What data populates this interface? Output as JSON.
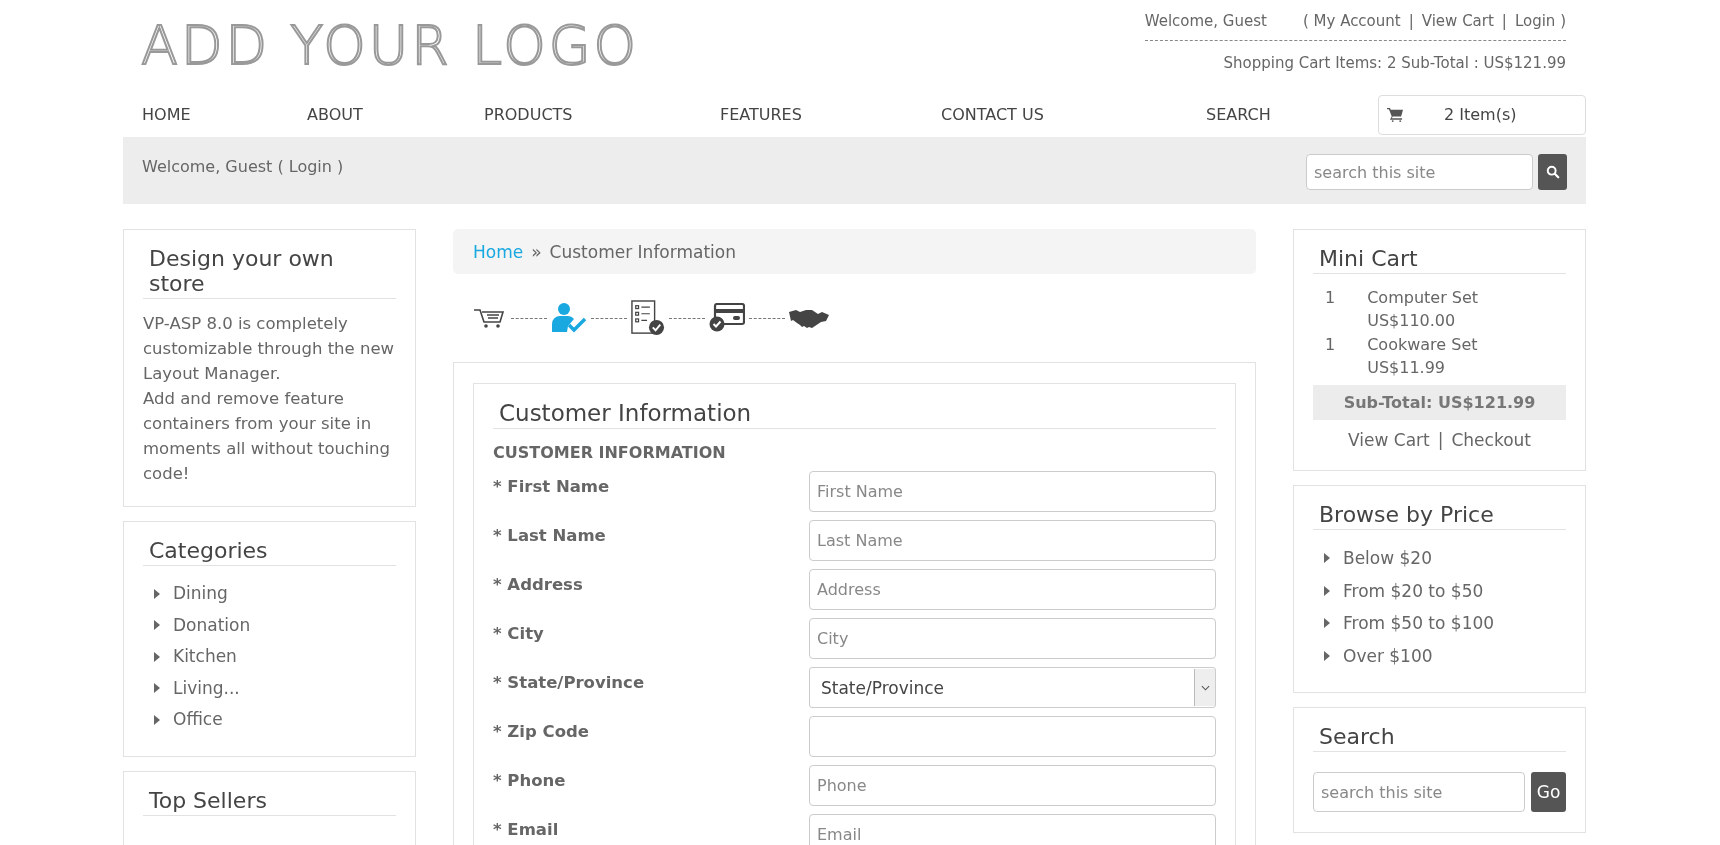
{
  "logo": {
    "text": "ADD YOUR LOGO"
  },
  "account_bar": {
    "welcome": "Welcome, Guest",
    "links": [
      "( My Account",
      "|",
      "View Cart",
      "|",
      "Login )"
    ],
    "cart_summary": "Shopping Cart Items: 2  Sub-Total : US$121.99"
  },
  "nav": {
    "items": [
      "HOME",
      "ABOUT",
      "PRODUCTS",
      "FEATURES",
      "CONTACT US",
      "SEARCH"
    ],
    "cart_button": "2 Item(s)"
  },
  "welcome_bar": {
    "text": "Welcome, Guest ( Login )",
    "search": {
      "placeholder": "search this site"
    }
  },
  "left": {
    "design": {
      "title": "Design your own store",
      "text": "VP-ASP 8.0 is completely customizable through the new Layout Manager.\nAdd and remove feature containers from your site in moments all without touching code!"
    },
    "categories": {
      "title": "Categories",
      "items": [
        "Dining",
        "Donation",
        "Kitchen",
        "Living...",
        "Office"
      ]
    },
    "top_sellers": {
      "title": "Top Sellers"
    }
  },
  "breadcrumb": {
    "home": "Home",
    "separator": "»",
    "current": "Customer Information"
  },
  "steps": [
    {
      "kind": "cart",
      "selected": false
    },
    {
      "kind": "customer",
      "selected": true
    },
    {
      "kind": "review",
      "selected": false
    },
    {
      "kind": "payment",
      "selected": false
    },
    {
      "kind": "complete",
      "selected": false
    }
  ],
  "form": {
    "title": "Customer Information",
    "section": "CUSTOMER INFORMATION",
    "fields": [
      {
        "label": "* First Name",
        "kind": "text",
        "placeholder": "First Name"
      },
      {
        "label": "* Last Name",
        "kind": "text",
        "placeholder": "Last Name"
      },
      {
        "label": "* Address",
        "kind": "text",
        "placeholder": "Address"
      },
      {
        "label": "* City",
        "kind": "text",
        "placeholder": "City"
      },
      {
        "label": "* State/Province",
        "kind": "select",
        "value": "State/Province"
      },
      {
        "label": "* Zip Code",
        "kind": "text"
      },
      {
        "label": "* Phone",
        "kind": "text",
        "placeholder": "Phone"
      },
      {
        "label": "* Email",
        "kind": "text",
        "placeholder": "Email"
      }
    ]
  },
  "mini_cart": {
    "title": "Mini Cart",
    "items": [
      {
        "qty": "1",
        "name": "Computer Set",
        "price": "US$110.00"
      },
      {
        "qty": "1",
        "name": "Cookware Set",
        "price": "US$11.99"
      }
    ],
    "subtotal": "Sub-Total: US$121.99",
    "links": [
      "View Cart",
      "|",
      "Checkout"
    ]
  },
  "browse_by_price": {
    "title": "Browse by Price",
    "items": [
      "Below $20",
      "From $20 to $50",
      "From $50 to $100",
      "Over $100"
    ]
  },
  "search_box": {
    "title": "Search",
    "placeholder": "search this site",
    "button": "Go"
  }
}
